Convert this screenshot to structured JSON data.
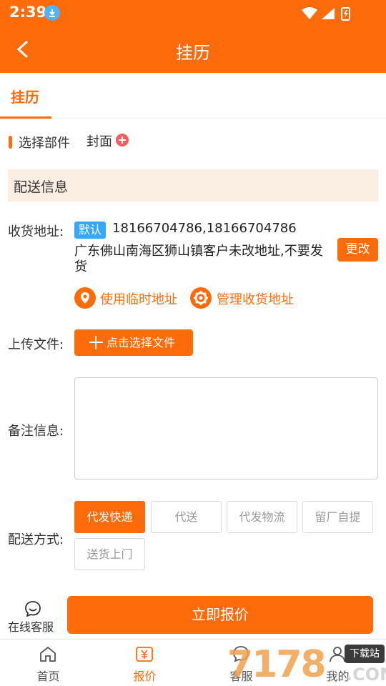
{
  "status": {
    "time": "2:39"
  },
  "appbar": {
    "title": "挂历"
  },
  "tabs": [
    {
      "label": "挂历",
      "active": true
    }
  ],
  "part": {
    "label": "选择部件",
    "value": "封面"
  },
  "delivery_section": {
    "title": "配送信息"
  },
  "address": {
    "label": "收货地址:",
    "badge": "默认",
    "phones": "18166704786,18166704786",
    "text": "广东佛山南海区狮山镇客户未改地址,不要发货",
    "change_label": "更改",
    "temp_link": "使用临时地址",
    "manage_link": "管理收货地址"
  },
  "upload": {
    "label": "上传文件:",
    "button": "点击选择文件"
  },
  "remark": {
    "label": "备注信息:",
    "value": ""
  },
  "shipping": {
    "label": "配送方式:",
    "options": [
      {
        "label": "代发快递",
        "active": true
      },
      {
        "label": "代送",
        "active": false
      },
      {
        "label": "代发物流",
        "active": false
      },
      {
        "label": "留厂自提",
        "active": false
      },
      {
        "label": "送货上门",
        "active": false
      }
    ]
  },
  "footer": {
    "cs_label": "在线客服",
    "quote_button": "立即报价"
  },
  "bottom_nav": [
    {
      "label": "首页",
      "icon": "home-icon",
      "active": false
    },
    {
      "label": "报价",
      "icon": "yen-icon",
      "active": true
    },
    {
      "label": "客服",
      "icon": "chat-icon",
      "active": false
    },
    {
      "label": "我的",
      "icon": "user-icon",
      "active": false
    }
  ],
  "watermark": {
    "number": "7178",
    "badge": "下载站",
    "suffix": ".COM"
  },
  "colors": {
    "accent": "#fd6b0a",
    "band": "#fbeee3",
    "badge": "#35a7ff"
  }
}
